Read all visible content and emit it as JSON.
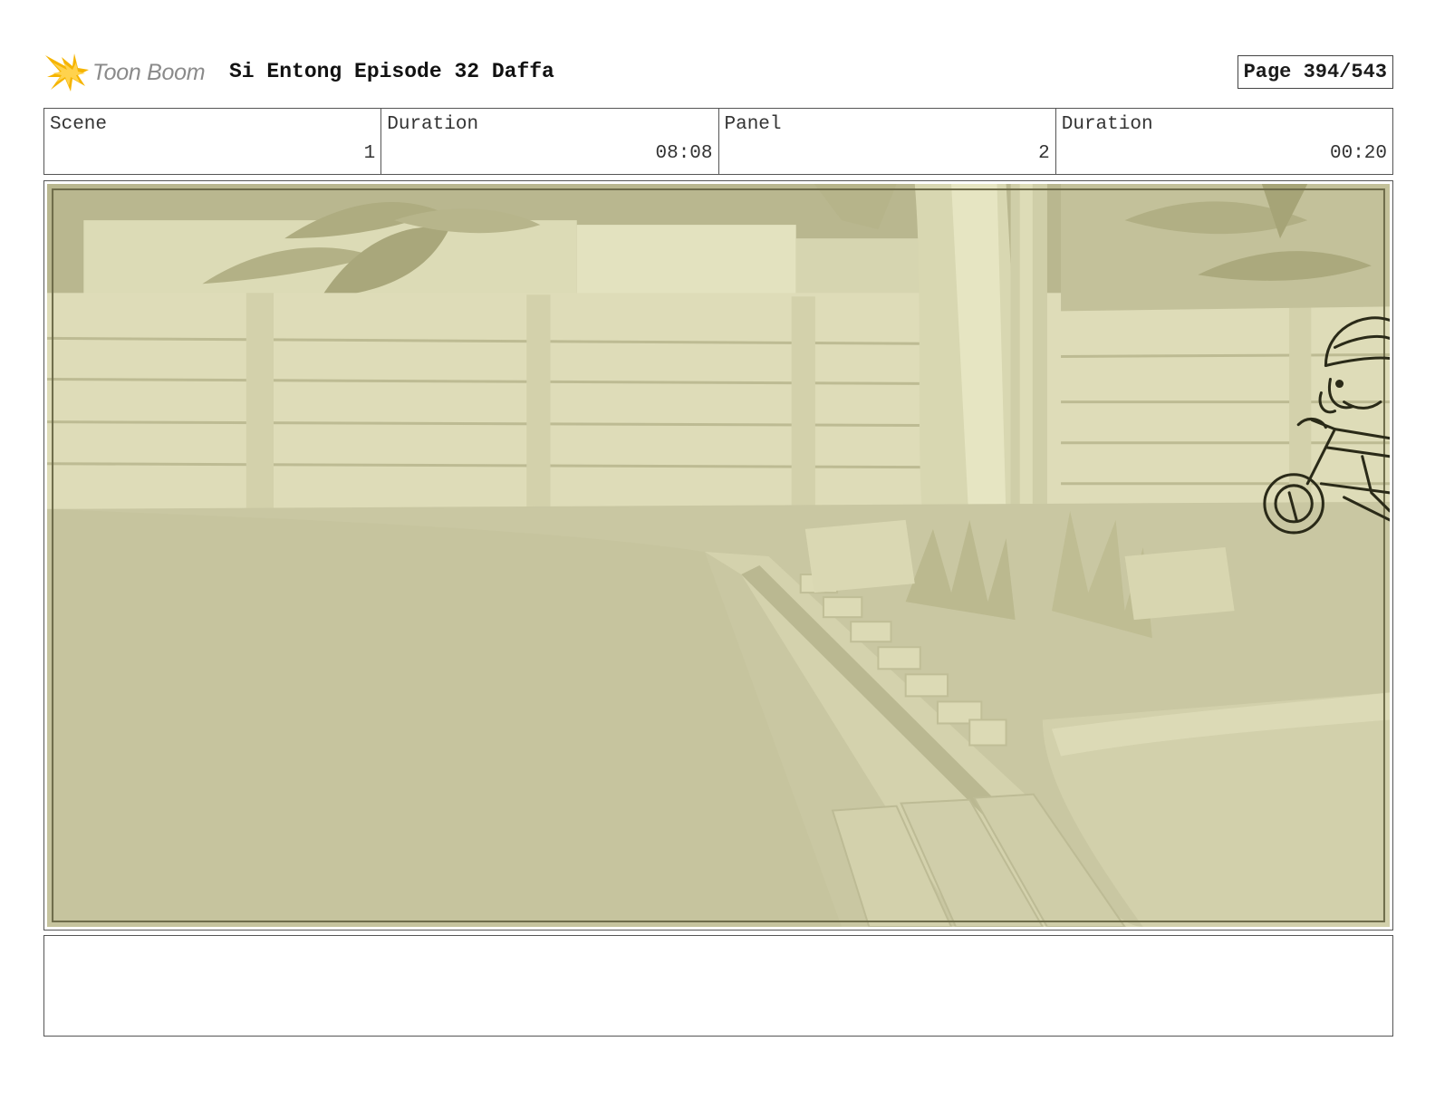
{
  "header": {
    "logo_text": "Toon Boom",
    "title": "Si Entong Episode 32 Daffa",
    "page": "Page 394/543"
  },
  "info": {
    "scene_label": "Scene",
    "scene_value": "1",
    "scene_duration_label": "Duration",
    "scene_duration_value": "08:08",
    "panel_label": "Panel",
    "panel_value": "2",
    "panel_duration_label": "Duration",
    "panel_duration_value": "00:20"
  },
  "notes": {
    "text": ""
  },
  "colors": {
    "logo_accent": "#f5b400",
    "panel_tint": "#cbc9a5",
    "sketch_line": "#2a2a18"
  }
}
